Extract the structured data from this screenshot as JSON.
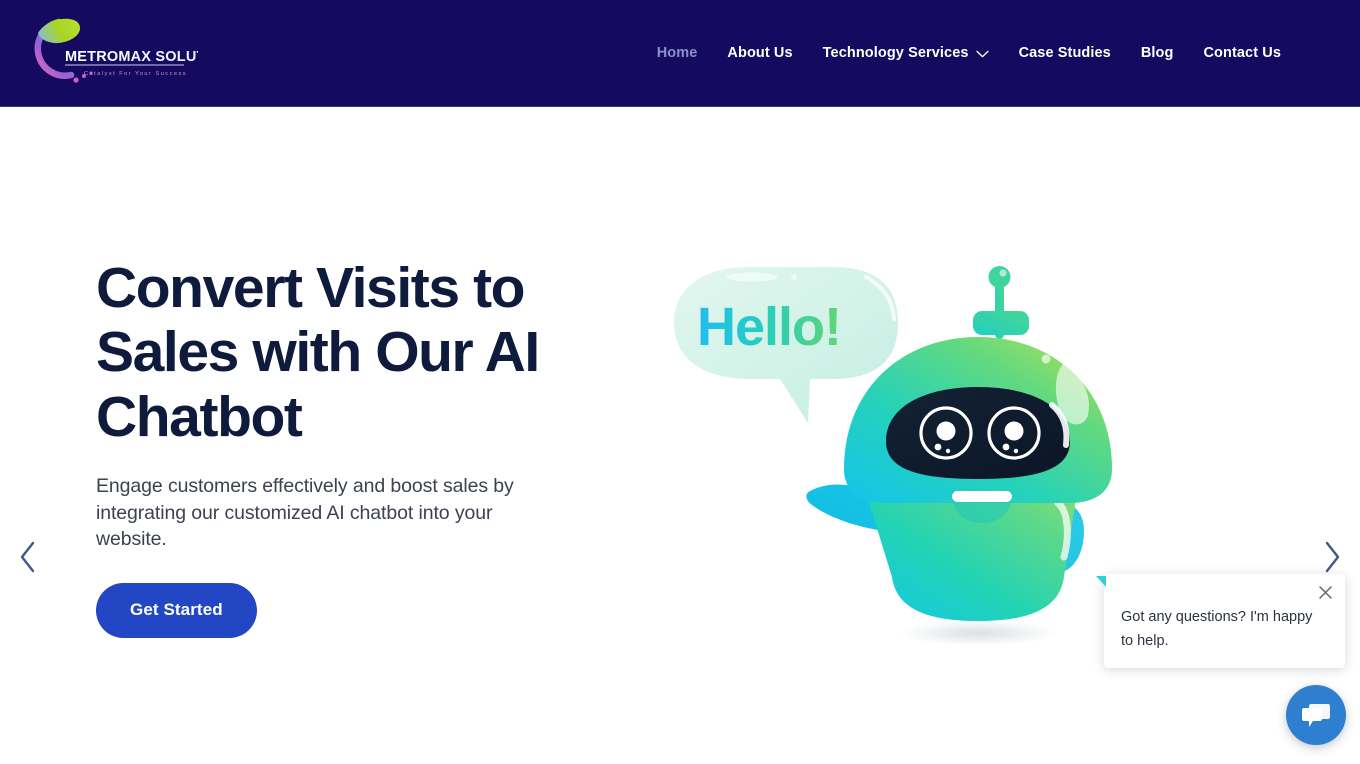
{
  "brand": {
    "name": "METROMAX SOLUTIONS",
    "tagline": "Catalyst For Your Success",
    "logo_icon": "metromax-swoosh-logo",
    "colors": {
      "swoosh_green": "#a8d426",
      "swoosh_purple": "#8b5ad6",
      "swoosh_pink": "#e86bc0"
    }
  },
  "header": {
    "background": "#140a60",
    "nav": [
      {
        "label": "Home",
        "active": true
      },
      {
        "label": "About Us",
        "active": false
      },
      {
        "label": "Technology Services",
        "active": false,
        "has_dropdown": true,
        "dropdown_icon": "chevron-down-icon"
      },
      {
        "label": "Case Studies",
        "active": false
      },
      {
        "label": "Blog",
        "active": false
      },
      {
        "label": "Contact Us",
        "active": false
      }
    ],
    "active_color": "#8b90c8",
    "link_color": "#ffffff"
  },
  "hero": {
    "headline": "Convert Visits to Sales with Our AI Chatbot",
    "subheadline": "Engage customers effectively and boost sales by integrating our customized AI chatbot into your website.",
    "cta_label": "Get Started",
    "cta_color": "#2346c4",
    "headline_color": "#0e1b3d",
    "illustration": {
      "name": "ai-chatbot-robot-illustration",
      "speech_bubble_text": "Hello!",
      "bubble_fill": "#d7f3ea",
      "text_gradient_from": "#25c3ee",
      "text_gradient_to": "#5fd37e",
      "robot_gradient_from": "#18c9e8",
      "robot_gradient_to": "#b5e05a",
      "visor_color": "#0e1f33"
    }
  },
  "carousel": {
    "prev_icon": "chevron-left-icon",
    "next_icon": "chevron-right-icon",
    "arrow_color": "#3d5a86"
  },
  "chat_widget": {
    "message": "Got any questions? I'm happy to help.",
    "close_icon": "close-icon",
    "fab_icon": "chat-bubbles-icon",
    "fab_color": "#2f7fd1"
  }
}
